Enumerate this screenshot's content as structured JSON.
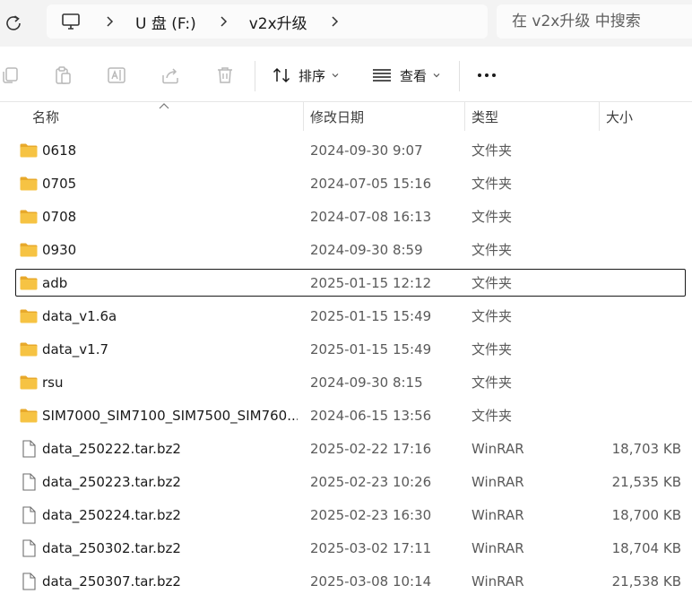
{
  "address_bar": {
    "crumbs": [
      {
        "label": "U 盘 (F:)"
      },
      {
        "label": "v2x升级"
      }
    ],
    "search_placeholder": "在 v2x升级 中搜索"
  },
  "toolbar": {
    "sort_label": "排序",
    "view_label": "查看"
  },
  "columns": {
    "name": "名称",
    "date": "修改日期",
    "type": "类型",
    "size": "大小"
  },
  "files": [
    {
      "name": "0618",
      "date": "2024-09-30 9:07",
      "type": "文件夹",
      "size": "",
      "kind": "folder"
    },
    {
      "name": "0705",
      "date": "2024-07-05 15:16",
      "type": "文件夹",
      "size": "",
      "kind": "folder"
    },
    {
      "name": "0708",
      "date": "2024-07-08 16:13",
      "type": "文件夹",
      "size": "",
      "kind": "folder"
    },
    {
      "name": "0930",
      "date": "2024-09-30 8:59",
      "type": "文件夹",
      "size": "",
      "kind": "folder"
    },
    {
      "name": "adb",
      "date": "2025-01-15 12:12",
      "type": "文件夹",
      "size": "",
      "kind": "folder",
      "selected": true
    },
    {
      "name": "data_v1.6a",
      "date": "2025-01-15 15:49",
      "type": "文件夹",
      "size": "",
      "kind": "folder"
    },
    {
      "name": "data_v1.7",
      "date": "2025-01-15 15:49",
      "type": "文件夹",
      "size": "",
      "kind": "folder"
    },
    {
      "name": "rsu",
      "date": "2024-09-30 8:15",
      "type": "文件夹",
      "size": "",
      "kind": "folder"
    },
    {
      "name": "SIM7000_SIM7100_SIM7500_SIM760...",
      "date": "2024-06-15 13:56",
      "type": "文件夹",
      "size": "",
      "kind": "folder"
    },
    {
      "name": "data_250222.tar.bz2",
      "date": "2025-02-22 17:16",
      "type": "WinRAR",
      "size": "18,703 KB",
      "kind": "file"
    },
    {
      "name": "data_250223.tar.bz2",
      "date": "2025-02-23 10:26",
      "type": "WinRAR",
      "size": "21,535 KB",
      "kind": "file"
    },
    {
      "name": "data_250224.tar.bz2",
      "date": "2025-02-23 16:30",
      "type": "WinRAR",
      "size": "18,700 KB",
      "kind": "file"
    },
    {
      "name": "data_250302.tar.bz2",
      "date": "2025-03-02 17:11",
      "type": "WinRAR",
      "size": "18,704 KB",
      "kind": "file"
    },
    {
      "name": "data_250307.tar.bz2",
      "date": "2025-03-08 10:14",
      "type": "WinRAR",
      "size": "21,538 KB",
      "kind": "file"
    }
  ],
  "colors": {
    "folder": "#f6c343",
    "folder_dark": "#e8a92b",
    "accent": "#1a1a1a",
    "muted_icon": "#b8b8b8"
  }
}
